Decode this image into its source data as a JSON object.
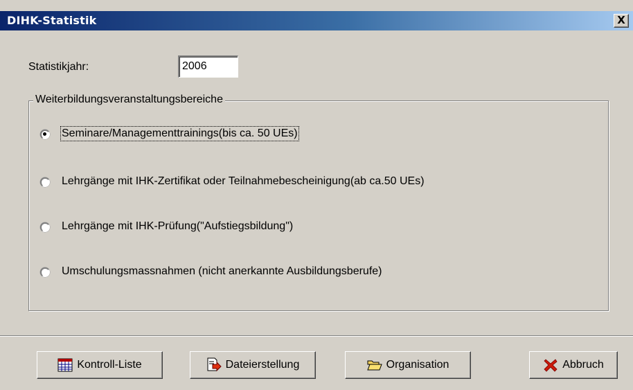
{
  "window": {
    "title": "DIHK-Statistik",
    "close_label": "X"
  },
  "form": {
    "year_label": "Statistikjahr:",
    "year_value": "2006"
  },
  "group": {
    "title": "Weiterbildungsveranstaltungsbereiche",
    "options": [
      {
        "label": "Seminare/Managementtrainings(bis ca. 50 UEs)",
        "selected": true
      },
      {
        "label": "Lehrgänge mit IHK-Zertifikat oder Teilnahmebescheinigung(ab ca.50 UEs)",
        "selected": false
      },
      {
        "label": "Lehrgänge mit IHK-Prüfung(\"Aufstiegsbildung\")",
        "selected": false
      },
      {
        "label": "Umschulungsmassnahmen (nicht anerkannte Ausbildungsberufe)",
        "selected": false
      }
    ]
  },
  "buttons": {
    "control_list": {
      "label": "Kontroll-Liste",
      "icon": "calendar-grid-icon"
    },
    "file_create": {
      "label": "Dateierstellung",
      "icon": "document-arrow-icon"
    },
    "organisation": {
      "label": "Organisation",
      "icon": "open-folder-icon"
    },
    "cancel": {
      "label": "Abbruch",
      "icon": "red-x-icon"
    }
  },
  "colors": {
    "titlebar_start": "#0a246a",
    "titlebar_end": "#a6caf0",
    "face": "#d4d0c8",
    "cancel_icon": "#cc1a0a"
  }
}
